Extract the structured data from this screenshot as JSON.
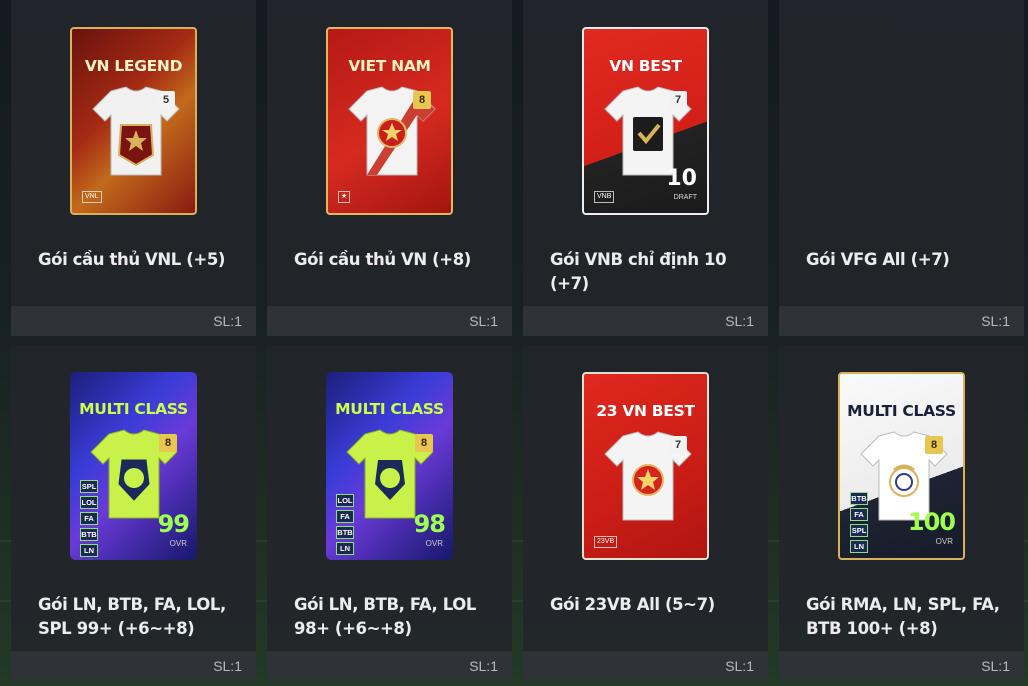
{
  "packs": [
    {
      "card_name": "VN LEGEND",
      "boost": "5",
      "tag": "VNL",
      "title": "Gói cầu thủ VNL (+5)",
      "qty": "SL:1"
    },
    {
      "card_name": "VIET NAM",
      "boost": "8",
      "tag": "★",
      "title": "Gói cầu thủ VN (+8)",
      "qty": "SL:1"
    },
    {
      "card_name": "VN BEST",
      "boost": "7",
      "tag": "VNB",
      "draft_number": "10",
      "draft_label": "DRAFT",
      "title": "Gói VNB chỉ định 10 (+7)",
      "qty": "SL:1"
    },
    {
      "title": "Gói VFG All (+7)",
      "qty": "SL:1"
    },
    {
      "card_name": "MULTI CLASS",
      "boost": "8",
      "leagues": [
        "SPL",
        "LOL",
        "FA",
        "BTB",
        "LN"
      ],
      "ovr": "99",
      "ovr_label": "OVR",
      "title": "Gói LN, BTB, FA, LOL, SPL 99+ (+6~+8)",
      "qty": "SL:1"
    },
    {
      "card_name": "MULTI CLASS",
      "boost": "8",
      "leagues": [
        "LOL",
        "FA",
        "BTB",
        "LN"
      ],
      "ovr": "98",
      "ovr_label": "OVR",
      "title": "Gói LN, BTB, FA, LOL 98+ (+6~+8)",
      "qty": "SL:1"
    },
    {
      "card_name": "23 VN BEST",
      "boost": "7",
      "tag": "23VB",
      "title": "Gói 23VB All (5~7)",
      "qty": "SL:1"
    },
    {
      "card_name": "MULTI CLASS",
      "boost": "8",
      "leagues": [
        "BTB",
        "FA",
        "SPL",
        "LN"
      ],
      "ovr": "100",
      "ovr_label": "OVR",
      "title": "Gói RMA, LN, SPL, FA, BTB 100+ (+8)",
      "qty": "SL:1"
    }
  ],
  "colors": {
    "vnl": "#8b1a12",
    "vn": "#c8201b",
    "vnb": "#d8231d",
    "multi": "#2a2bb0",
    "rma": "#f1f1f1",
    "accent_green": "#9dff4f",
    "gold": "#d6b25a"
  },
  "icons": [
    "shirt-icon",
    "league-badge-icon",
    "star-icon",
    "checkmark-icon",
    "lion-crest-icon",
    "real-madrid-crest-icon"
  ]
}
